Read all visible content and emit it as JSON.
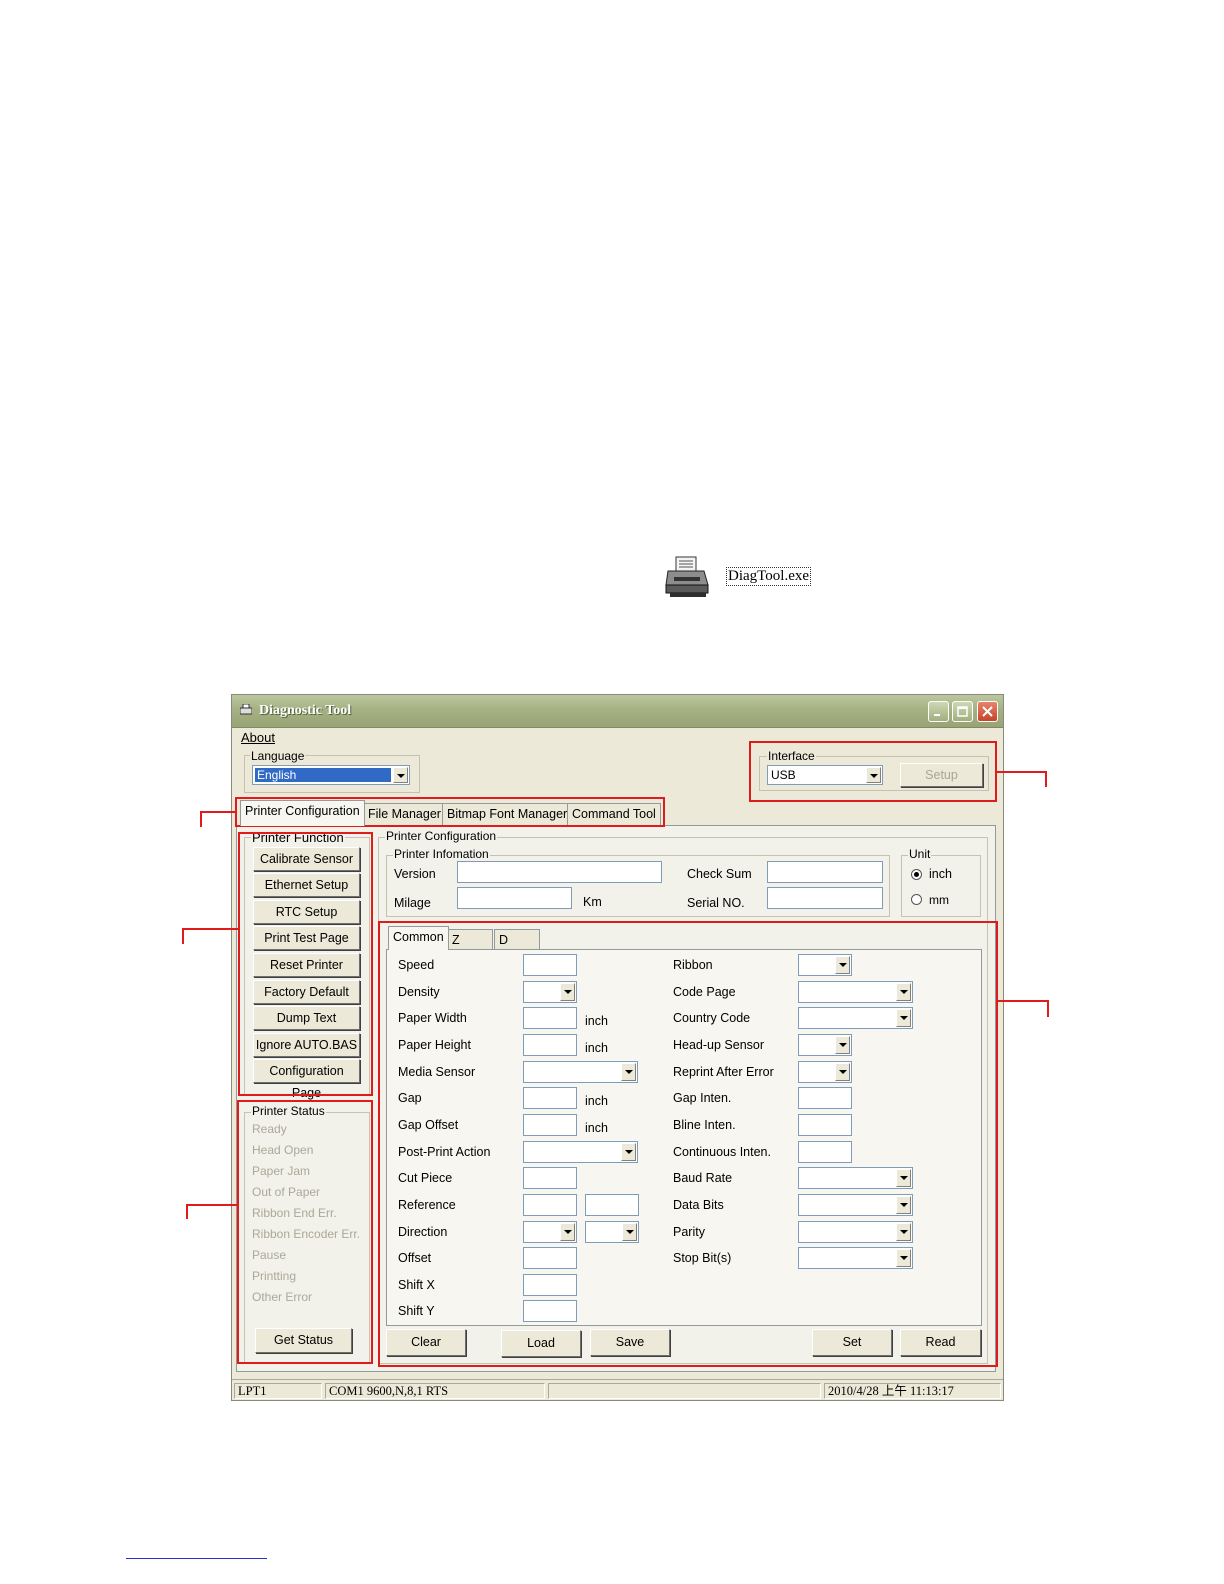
{
  "desktop_icon": {
    "name": "DiagTool.exe",
    "icon": "printer-icon"
  },
  "window": {
    "title": "Diagnostic Tool",
    "menu": {
      "about": "About"
    },
    "language": {
      "label": "Language",
      "value": "English"
    },
    "interface": {
      "label": "Interface",
      "value": "USB",
      "setup_button": "Setup"
    },
    "tabs": [
      "Printer Configuration",
      "File Manager",
      "Bitmap Font Manager",
      "Command Tool"
    ],
    "printer_function": {
      "label": "Printer Function",
      "buttons": [
        "Calibrate Sensor",
        "Ethernet Setup",
        "RTC Setup",
        "Print Test Page",
        "Reset Printer",
        "Factory Default",
        "Dump Text",
        "Ignore AUTO.BAS",
        "Configuration Page"
      ]
    },
    "printer_status": {
      "label": "Printer Status",
      "items": [
        "Ready",
        "Head Open",
        "Paper Jam",
        "Out of Paper",
        "Ribbon End Err.",
        "Ribbon Encoder Err.",
        "Pause",
        "Printting",
        "Other Error"
      ],
      "get_status_button": "Get Status"
    },
    "printer_configuration": {
      "label": "Printer Configuration",
      "info": {
        "label": "Printer Infomation",
        "version": "Version",
        "milage": "Milage",
        "km": "Km",
        "check_sum": "Check Sum",
        "serial_no": "Serial NO."
      },
      "unit": {
        "label": "Unit",
        "inch": "inch",
        "mm": "mm",
        "selected": "inch"
      },
      "subtabs": [
        "Common",
        "Z",
        "D"
      ],
      "left_fields": {
        "speed": "Speed",
        "density": "Density",
        "paper_width": "Paper Width",
        "paper_height": "Paper Height",
        "media_sensor": "Media Sensor",
        "gap": "Gap",
        "gap_offset": "Gap Offset",
        "post_print_action": "Post-Print Action",
        "cut_piece": "Cut Piece",
        "reference": "Reference",
        "direction": "Direction",
        "offset": "Offset",
        "shift_x": "Shift X",
        "shift_y": "Shift Y",
        "inch": "inch"
      },
      "right_fields": {
        "ribbon": "Ribbon",
        "code_page": "Code Page",
        "country_code": "Country Code",
        "head_up_sensor": "Head-up Sensor",
        "reprint_after_error": "Reprint After Error",
        "gap_inten": "Gap Inten.",
        "bline_inten": "Bline Inten.",
        "continuous_inten": "Continuous Inten.",
        "baud_rate": "Baud Rate",
        "data_bits": "Data Bits",
        "parity": "Parity",
        "stop_bits": "Stop Bit(s)"
      },
      "buttons": {
        "clear": "Clear",
        "load": "Load",
        "save": "Save",
        "set": "Set",
        "read": "Read"
      }
    },
    "statusbar": {
      "port": "LPT1",
      "com": "COM1 9600,N,8,1 RTS",
      "middle": "",
      "datetime": "2010/4/28 上午 11:13:17"
    }
  },
  "colors": {
    "highlight_box": "#e01b1b",
    "window_bg": "#ece9d8",
    "titlebar": "#a5b183"
  }
}
